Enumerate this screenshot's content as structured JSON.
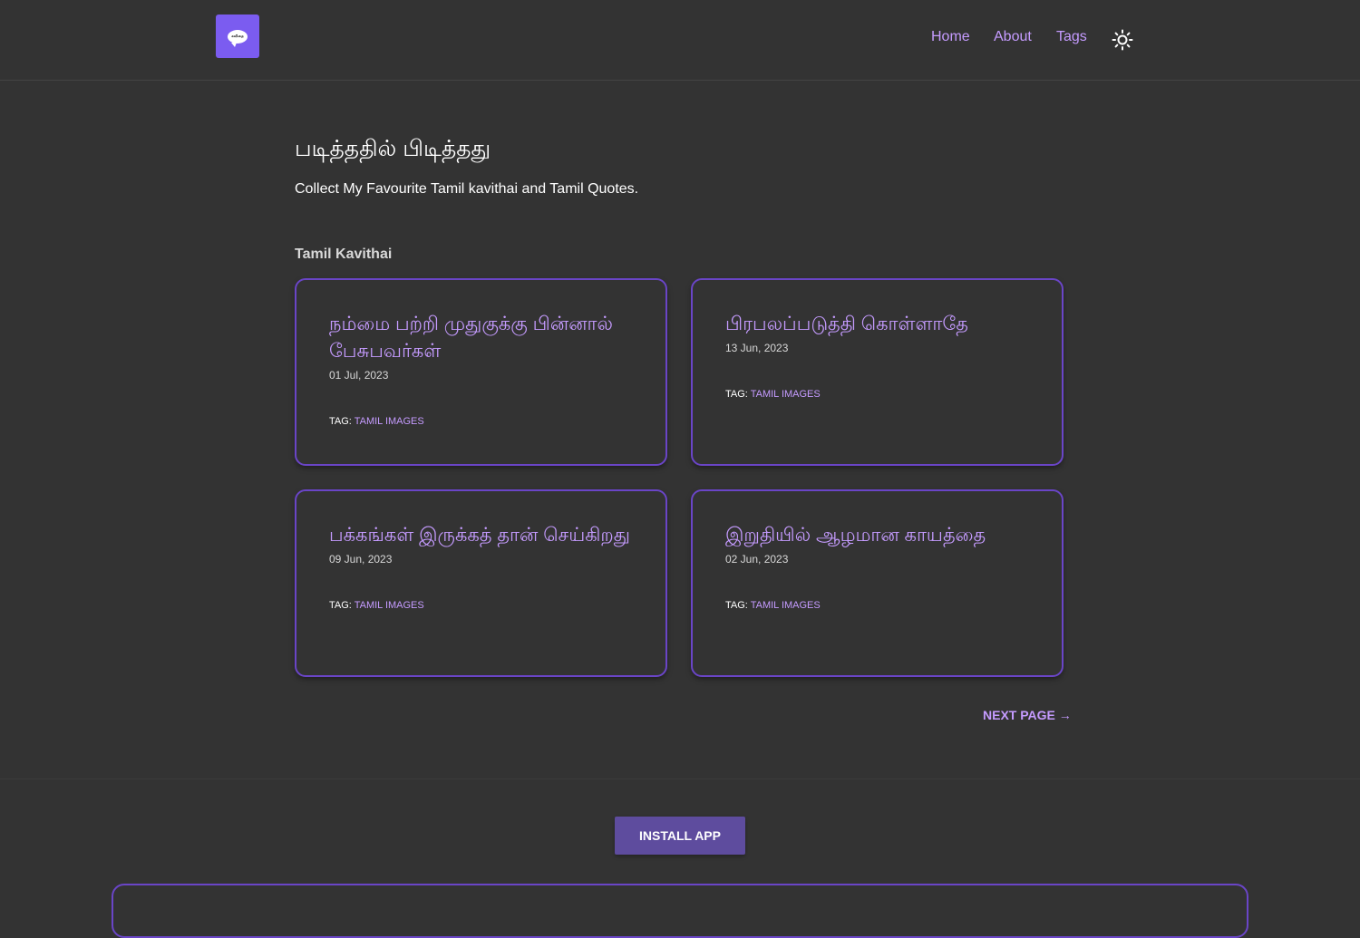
{
  "header": {
    "logo_text": "கவிதை",
    "nav": {
      "home": "Home",
      "about": "About",
      "tags": "Tags"
    },
    "theme_icon": "sun-icon"
  },
  "main": {
    "title": "படித்ததில் பிடித்தது",
    "description": "Collect My Favourite Tamil kavithai and Tamil Quotes.",
    "section_title": "Tamil Kavithai",
    "posts": [
      {
        "title": "நம்மை பற்றி முதுகுக்கு பின்னால் பேசுபவர்கள்",
        "date": "01 Jul, 2023",
        "tag_label": "TAG:",
        "tag": "TAMIL IMAGES"
      },
      {
        "title": "பிரபலப்படுத்தி கொள்ளாதே",
        "date": "13 Jun, 2023",
        "tag_label": "TAG:",
        "tag": "TAMIL IMAGES"
      },
      {
        "title": "பக்கங்கள் இருக்கத் தான் செய்கிறது",
        "date": "09 Jun, 2023",
        "tag_label": "TAG:",
        "tag": "TAMIL IMAGES"
      },
      {
        "title": "இறுதியில் ஆழமான காயத்தை",
        "date": "02 Jun, 2023",
        "tag_label": "TAG:",
        "tag": "TAMIL IMAGES"
      }
    ],
    "next_page": "NEXT PAGE →"
  },
  "footer": {
    "install_label": "INSTALL APP"
  },
  "colors": {
    "background": "#333333",
    "accent": "#c59bff",
    "border": "#6a45c7",
    "button": "#5e4c9e"
  }
}
